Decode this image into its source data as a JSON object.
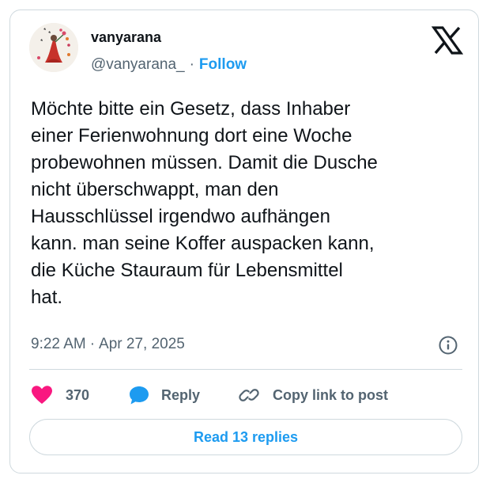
{
  "author": {
    "display_name": "vanyarana",
    "handle": "@vanyarana_",
    "separator": "·",
    "follow_label": "Follow"
  },
  "tweet": {
    "lines": [
      "Möchte bitte ein Gesetz, dass Inhaber",
      "einer Ferienwohnung dort eine Woche",
      "probewohnen müssen. Damit die Dusche",
      "nicht überschwappt, man den",
      "Hausschlüssel irgendwo aufhängen",
      "kann. man seine Koffer auspacken kann,",
      "die Küche Stauraum für Lebensmittel",
      "hat."
    ],
    "time": "9:22 AM",
    "separator": "·",
    "date": "Apr 27, 2025"
  },
  "actions": {
    "like_count": "370",
    "reply_label": "Reply",
    "copy_label": "Copy link to post"
  },
  "read_replies_label": "Read 13 replies",
  "colors": {
    "accent": "#1d9bf0",
    "like": "#f91880",
    "text": "#0f1419",
    "secondary_text": "#536471",
    "border": "#cfd9de"
  },
  "icons": [
    "x-logo-icon",
    "info-icon",
    "heart-icon",
    "reply-bubble-icon",
    "link-icon"
  ]
}
